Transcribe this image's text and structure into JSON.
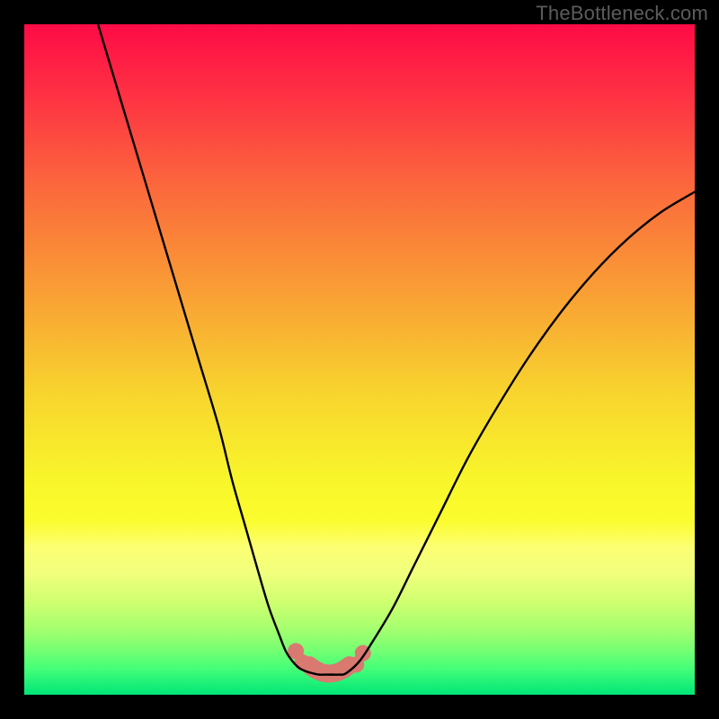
{
  "watermark": "TheBottleneck.com",
  "chart_data": {
    "type": "line",
    "title": "",
    "xlabel": "",
    "ylabel": "",
    "xlim": [
      0,
      100
    ],
    "ylim": [
      0,
      100
    ],
    "series": [
      {
        "name": "left-curve",
        "x": [
          11,
          14,
          17,
          20,
          23,
          26,
          29,
          31,
          33,
          35,
          36.5,
          38,
          39,
          40,
          41,
          42,
          43
        ],
        "values": [
          100,
          90,
          80,
          70,
          60,
          50,
          40,
          32,
          25,
          18,
          13,
          9,
          6.5,
          5,
          4,
          3.5,
          3.2
        ]
      },
      {
        "name": "trough",
        "x": [
          43,
          44,
          45,
          46,
          47,
          48
        ],
        "values": [
          3.2,
          3.0,
          3.0,
          3.0,
          3.0,
          3.2
        ]
      },
      {
        "name": "right-curve",
        "x": [
          48,
          50,
          52,
          55,
          58,
          62,
          66,
          70,
          75,
          80,
          85,
          90,
          95,
          100
        ],
        "values": [
          3.2,
          5,
          8,
          13,
          19,
          27,
          35,
          42,
          50,
          57,
          63,
          68,
          72,
          75
        ]
      }
    ],
    "markers": {
      "name": "trough-highlight",
      "color": "#d97970",
      "points": [
        {
          "x": 40.5,
          "y": 6.5
        },
        {
          "x": 41.5,
          "y": 4.8
        },
        {
          "x": 49.5,
          "y": 4.5
        },
        {
          "x": 50.5,
          "y": 6.2
        }
      ],
      "band": {
        "x1": 42.5,
        "x2": 48.5,
        "y": 3.1
      }
    },
    "background_gradient": {
      "stops": [
        {
          "offset": 0.0,
          "color": "#fe0b46"
        },
        {
          "offset": 0.1,
          "color": "#fe2f44"
        },
        {
          "offset": 0.25,
          "color": "#fb6b3c"
        },
        {
          "offset": 0.4,
          "color": "#f99f35"
        },
        {
          "offset": 0.55,
          "color": "#f8d42e"
        },
        {
          "offset": 0.68,
          "color": "#f8f62b"
        },
        {
          "offset": 0.74,
          "color": "#fbfc2e"
        },
        {
          "offset": 0.78,
          "color": "#fcff73"
        },
        {
          "offset": 0.82,
          "color": "#f0ff7d"
        },
        {
          "offset": 0.86,
          "color": "#d0ff70"
        },
        {
          "offset": 0.9,
          "color": "#a7ff6f"
        },
        {
          "offset": 0.93,
          "color": "#7cff72"
        },
        {
          "offset": 0.96,
          "color": "#46ff78"
        },
        {
          "offset": 1.0,
          "color": "#00e577"
        }
      ]
    }
  }
}
